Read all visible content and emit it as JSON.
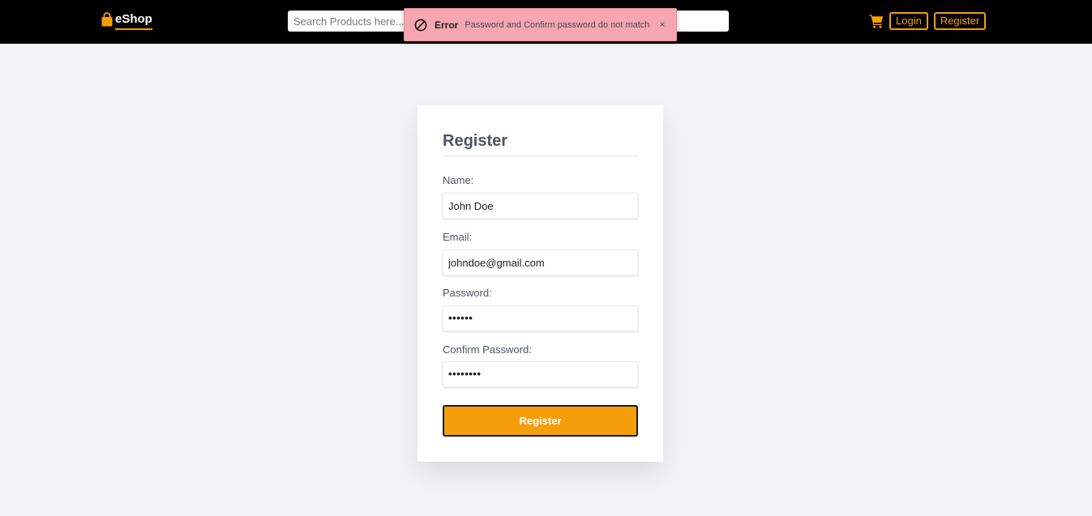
{
  "nav": {
    "brand": "eShop",
    "search_placeholder": "Search Products here...",
    "login_label": "Login",
    "register_label": "Register",
    "cart_icon": "cart-icon",
    "brand_icon": "shopping-bag-icon"
  },
  "toast": {
    "icon": "ban-icon",
    "title": "Error",
    "message": "Password and Confirm password do not match",
    "close": "×"
  },
  "form": {
    "title": "Register",
    "fields": [
      {
        "label": "Name:",
        "value": "John Doe",
        "type": "text"
      },
      {
        "label": "Email:",
        "value": "johndoe@gmail.com",
        "type": "email"
      },
      {
        "label": "Password:",
        "value": "••••••",
        "type": "password"
      },
      {
        "label": "Confirm Password:",
        "value": "••••••••",
        "type": "password"
      }
    ],
    "submit_label": "Register"
  },
  "colors": {
    "accent": "#f59e0b",
    "navbar": "#000000",
    "page_bg": "#f3f4f6",
    "toast_bg": "#f6a6b0"
  }
}
